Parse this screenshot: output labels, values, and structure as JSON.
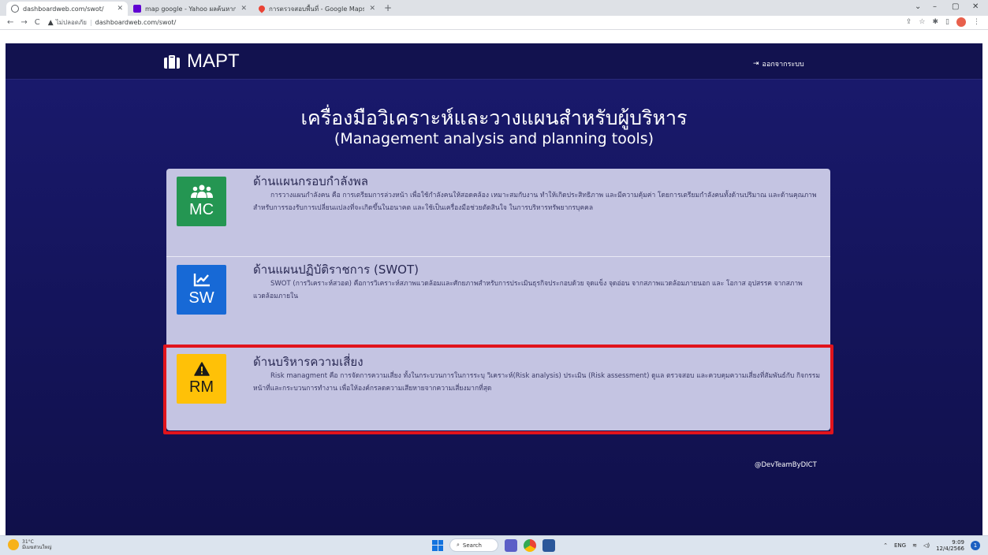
{
  "browser": {
    "tabs": [
      {
        "title": "dashboardweb.com/swot/",
        "active": true,
        "favicon_color": "#5f6368"
      },
      {
        "title": "map google - Yahoo ผลค้นหาการค้นหา",
        "active": false,
        "favicon_color": "#6001d2"
      },
      {
        "title": "การตรวจสอบพื้นที่ - Google Maps",
        "active": false,
        "favicon_color": "#ea4335"
      }
    ],
    "close_glyph": "✕",
    "new_tab_glyph": "+",
    "window_controls": [
      "⌄",
      "–",
      "▢",
      "✕"
    ],
    "nav": {
      "back": "←",
      "forward": "→",
      "reload": "C"
    },
    "address": {
      "security_label": "ไม่ปลอดภัย",
      "separator": "|",
      "url": "dashboardweb.com/swot/"
    }
  },
  "page": {
    "brand": "MAPT",
    "logout_label": "ออกจากระบบ",
    "heading_th": "เครื่องมือวิเคราะห์และวางแผนสำหรับผู้บริหาร",
    "heading_en": "(Management analysis and planning tools)",
    "cards": [
      {
        "abbr": "MC",
        "color": "#249652",
        "icon": "users-icon",
        "title": "ด้านแผนกรอบกำลังพล",
        "description": "การวางแผนกำลังคน คือ การเตรียมการล่วงหน้า เพื่อใช้กำลังคนให้สอดคล้อง เหมาะสมกับงาน ทำให้เกิดประสิทธิภาพ และมีความคุ้มค่า โดยการเตรียมกำลังคนทั้งด้านปริมาณ และด้านคุณภาพ สำหรับการรองรับการเปลี่ยนแปลงที่จะเกิดขึ้นในอนาคต และใช้เป็นเครื่องมือช่วยตัดสินใจ ในการบริหารทรัพยากรบุคคล"
      },
      {
        "abbr": "SW",
        "color": "#1769d6",
        "icon": "chart-line-icon",
        "title": "ด้านแผนปฏิบัติราชการ (SWOT)",
        "description": "SWOT (การวิเคราะห์สวอต) คือการวิเคราะห์สภาพแวดล้อมและศักยภาพสำหรับการประเมินธุรกิจประกอบด้วย จุดแข็ง จุดอ่อน จากสภาพแวดล้อมภายนอก และ โอกาส อุปสรรค จากสภาพแวดล้อมภายใน"
      },
      {
        "abbr": "RM",
        "color": "#ffc107",
        "icon": "warning-icon",
        "title": "ด้านบริหารความเสี่ยง",
        "description": "Risk managment คือ การจัดการความเสี่ยง ทั้งในกระบวนการในการระบุ วิเคราะห์(Risk analysis) ประเมิน (Risk assessment) ดูแล ตรวจสอบ และควบคุมความเสี่ยงที่สัมพันธ์กับ กิจกรรม หน้าที่และกระบวนการทำงาน เพื่อให้องค์กรลดความเสียหายจากความเสี่ยงมากที่สุด"
      }
    ],
    "credit": "@DevTeamByDICT",
    "highlight_color": "#e1141c"
  },
  "taskbar": {
    "weather_temp": "31°C",
    "weather_desc": "มีเมฆส่วนใหญ่",
    "search_label": "Search",
    "language": "ENG",
    "time": "9:09",
    "date": "12/4/2566",
    "notification_count": "1"
  }
}
